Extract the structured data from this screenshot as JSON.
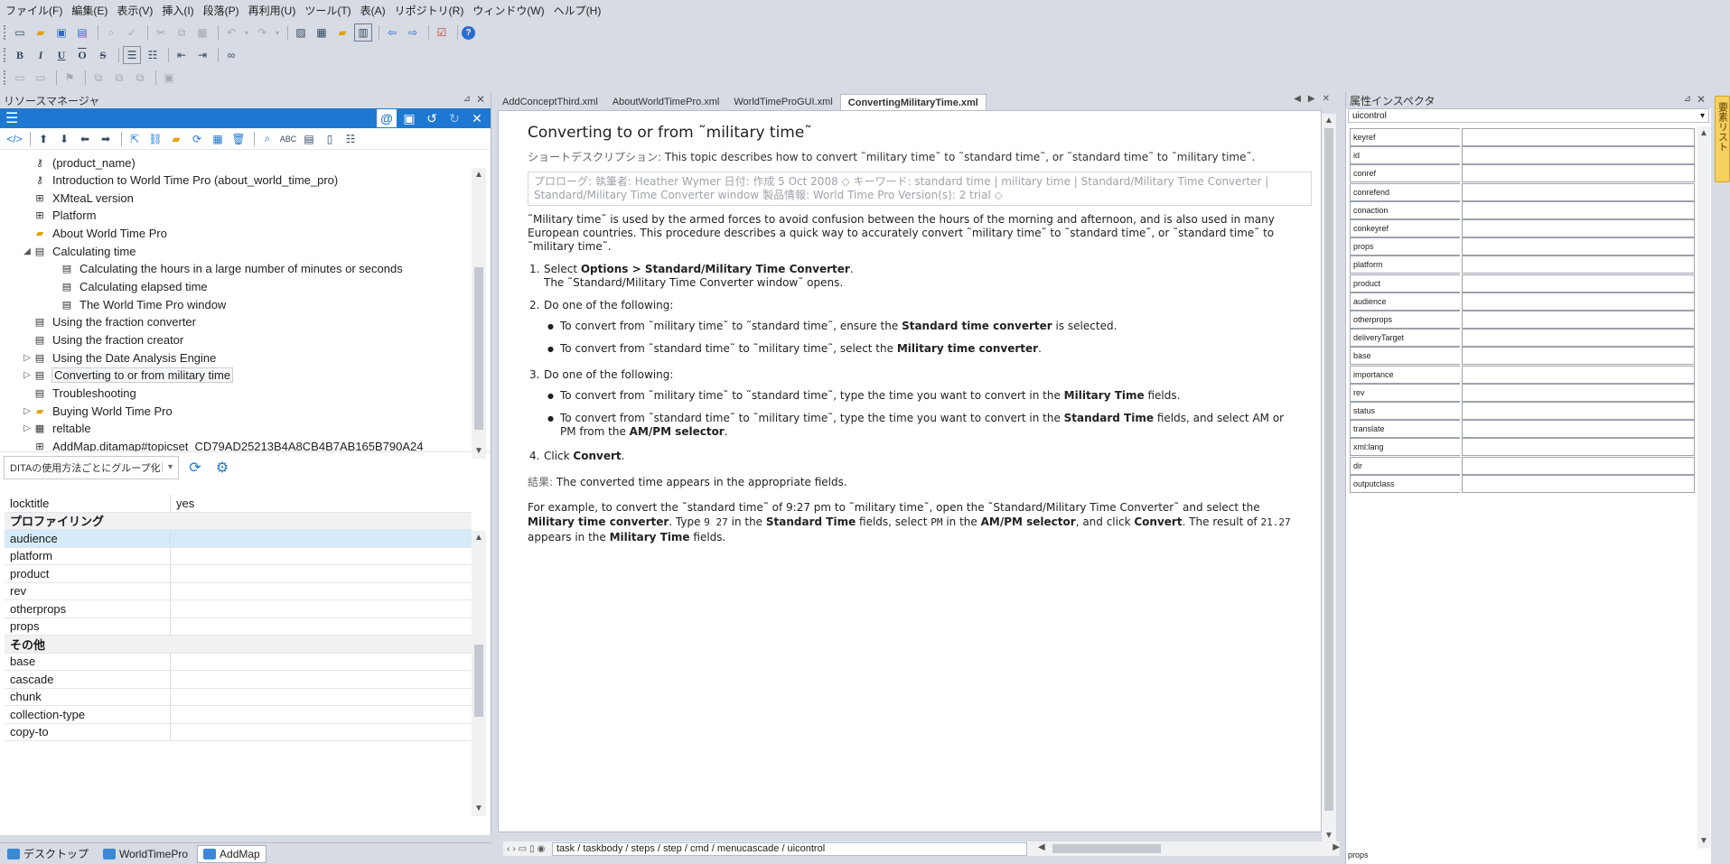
{
  "menubar": {
    "items": [
      "ファイル(F)",
      "編集(E)",
      "表示(V)",
      "挿入(I)",
      "段落(P)",
      "再利用(U)",
      "ツール(T)",
      "表(A)",
      "リポジトリ(R)",
      "ウィンドウ(W)",
      "ヘルプ(H)"
    ]
  },
  "resource_manager": {
    "title": "リソースマネージャ",
    "tree": [
      {
        "label": "(product_name)",
        "icon": "key-icon",
        "indent": 1,
        "expander": ""
      },
      {
        "label": "Introduction to World Time Pro (about_world_time_pro)",
        "icon": "key-icon",
        "indent": 1,
        "expander": ""
      },
      {
        "label": "XMteaL version",
        "icon": "map-ref-icon",
        "indent": 1,
        "expander": ""
      },
      {
        "label": "Platform",
        "icon": "map-ref-icon",
        "indent": 1,
        "expander": ""
      },
      {
        "label": "About World Time Pro",
        "icon": "folder-icon",
        "indent": 1,
        "expander": ""
      },
      {
        "label": "Calculating time",
        "icon": "topic-icon",
        "indent": 1,
        "expander": "◢"
      },
      {
        "label": "Calculating the hours in a large number of minutes or seconds",
        "icon": "topic-icon",
        "indent": 2,
        "expander": ""
      },
      {
        "label": "Calculating elapsed time",
        "icon": "topic-icon",
        "indent": 2,
        "expander": ""
      },
      {
        "label": "The World Time Pro window",
        "icon": "topic-icon",
        "indent": 2,
        "expander": ""
      },
      {
        "label": "Using the fraction converter",
        "icon": "topic-icon",
        "indent": 1,
        "expander": ""
      },
      {
        "label": "Using the fraction creator",
        "icon": "topic-icon",
        "indent": 1,
        "expander": ""
      },
      {
        "label": "Using the Date Analysis Engine",
        "icon": "topic-icon",
        "indent": 1,
        "expander": "▷"
      },
      {
        "label": "Converting to or from military time",
        "icon": "topic-icon",
        "indent": 1,
        "expander": "▷",
        "selected": true
      },
      {
        "label": "Troubleshooting",
        "icon": "topic-icon",
        "indent": 1,
        "expander": ""
      },
      {
        "label": "Buying World Time Pro",
        "icon": "folder-icon",
        "indent": 1,
        "expander": "▷"
      },
      {
        "label": "reltable",
        "icon": "table-icon",
        "indent": 1,
        "expander": "▷"
      },
      {
        "label": "AddMap.ditamap#topicset_CD79AD25213B4A8CB4B7AB165B790A24",
        "icon": "map-ref-icon",
        "indent": 1,
        "expander": ""
      }
    ],
    "group_select": "DITAの使用方法ごとにグループ化",
    "props": [
      {
        "name": "locktitle",
        "value": "yes",
        "type": "row"
      },
      {
        "name": "プロファイリング",
        "value": "",
        "type": "group"
      },
      {
        "name": "audience",
        "value": "",
        "type": "row",
        "highlight": true
      },
      {
        "name": "platform",
        "value": "",
        "type": "row"
      },
      {
        "name": "product",
        "value": "",
        "type": "row"
      },
      {
        "name": "rev",
        "value": "",
        "type": "row"
      },
      {
        "name": "otherprops",
        "value": "",
        "type": "row"
      },
      {
        "name": "props",
        "value": "",
        "type": "row"
      },
      {
        "name": "その他",
        "value": "",
        "type": "group"
      },
      {
        "name": "base",
        "value": "",
        "type": "row"
      },
      {
        "name": "cascade",
        "value": "",
        "type": "row"
      },
      {
        "name": "chunk",
        "value": "",
        "type": "row"
      },
      {
        "name": "collection-type",
        "value": "",
        "type": "row"
      },
      {
        "name": "copy-to",
        "value": "",
        "type": "row"
      }
    ]
  },
  "taskbar": {
    "items": [
      {
        "label": "デスクトップ",
        "active": false
      },
      {
        "label": "WorldTimePro",
        "active": false
      },
      {
        "label": "AddMap",
        "active": true
      }
    ]
  },
  "editor": {
    "tabs": [
      {
        "label": "AddConceptThird.xml",
        "active": false
      },
      {
        "label": "AboutWorldTimePro.xml",
        "active": false
      },
      {
        "label": "WorldTimeProGUI.xml",
        "active": false
      },
      {
        "label": "ConvertingMilitaryTime.xml",
        "active": true
      }
    ],
    "doc": {
      "title": "Converting to or from ˜military time˜",
      "shortdesc_label": "ショートデスクリプション:",
      "shortdesc": " This topic describes how to convert ˜military time˜ to ˜standard time˜, or ˜standard time˜ to ˜military time˜.",
      "prolog": "プロローグ:  執筆者: Heather Wymer 日付:  作成 5 Oct 2008 ◇ キーワード: standard time | military time | Standard/Military Time Converter | Standard/Military Time Converter window  製品情報: World Time Pro Version(s):  2 trial ◇",
      "context": "˜Military time˜ is used by the armed forces to avoid confusion between the hours of the morning and afternoon, and is also used in many European countries. This procedure describes a quick way to accurately convert ˜military time˜ to ˜standard time˜, or ˜standard time˜ to ˜military time˜.",
      "step1_a": "Select ",
      "step1_b": "Options > Standard/Military Time Converter",
      "step1_c": ".",
      "step1_result": "The ˜Standard/Military Time Converter window˜ opens.",
      "step2": "Do one of the following:",
      "step2_b1_a": "To convert from ˜military time˜ to ˜standard time˜, ensure the ",
      "step2_b1_b": "Standard time converter",
      "step2_b1_c": " is selected.",
      "step2_b2_a": "To convert from ˜standard time˜ to ˜military time˜, select the ",
      "step2_b2_b": "Military time converter",
      "step2_b2_c": ".",
      "step3": "Do one of the following:",
      "step3_b1_a": "To convert from ˜military time˜ to ˜standard time˜, type the time you want to convert in the ",
      "step3_b1_b": "Military Time",
      "step3_b1_c": " fields.",
      "step3_b2_a": "To convert from ˜standard time˜ to ˜military time˜, type the time you want to convert in the ",
      "step3_b2_b": "Standard Time",
      "step3_b2_c": " fields, and select AM or PM from the ",
      "step3_b2_d": "AM/PM selector",
      "step3_b2_e": ".",
      "step4_a": "Click ",
      "step4_b": "Convert",
      "step4_c": ".",
      "result_label": "結果:",
      "result": " The converted time appears in the appropriate fields.",
      "ex_1": "For example, to convert the ˜standard time˜ of 9:27 pm to ˜military time˜, open the ˜Standard/Military Time Converter˜ and select the ",
      "ex_2": "Military time converter",
      "ex_3": ". Type ",
      "ex_4": "9 27",
      "ex_5": " in the ",
      "ex_6": "Standard Time",
      "ex_7": " fields, select ",
      "ex_8": "PM",
      "ex_9": " in the ",
      "ex_10": "AM/PM selector",
      "ex_11": ", and click ",
      "ex_12": "Convert",
      "ex_13": ". The result of ",
      "ex_14": "21.27",
      "ex_15": " appears in the ",
      "ex_16": "Military Time",
      "ex_17": " fields."
    },
    "breadcrumb": "task / taskbody / steps / step / cmd / menucascade / uicontrol"
  },
  "inspector": {
    "title": "属性インスペクタ",
    "element": "uicontrol",
    "attributes": [
      "keyref",
      "id",
      "conref",
      "conrefend",
      "conaction",
      "conkeyref",
      "props",
      "platform",
      "product",
      "audience",
      "otherprops",
      "deliveryTarget",
      "base",
      "importance",
      "rev",
      "status",
      "translate",
      "xml:lang",
      "dir",
      "outputclass"
    ],
    "footer": "props"
  },
  "side_tab": "要素リスト"
}
